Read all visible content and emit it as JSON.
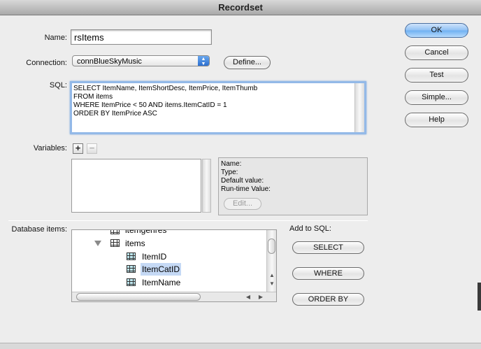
{
  "window": {
    "title": "Recordset"
  },
  "form": {
    "name_label": "Name:",
    "name_value": "rsItems",
    "connection_label": "Connection:",
    "connection_value": "connBlueSkyMusic",
    "define_button": "Define...",
    "sql_label": "SQL:",
    "sql_lines": [
      "SELECT ItemName, ItemShortDesc, ItemPrice, ItemThumb",
      "FROM items",
      "WHERE ItemPrice < 50 AND items.ItemCatID = 1",
      "ORDER BY ItemPrice ASC"
    ],
    "variables_label": "Variables:",
    "add_variable": "+",
    "remove_variable": "−",
    "variable_details": {
      "name": "Name:",
      "type": "Type:",
      "default_value": "Default value:",
      "runtime_value": "Run-time Value:",
      "edit_button": "Edit..."
    },
    "database_items_label": "Database items:",
    "add_to_sql_label": "Add to SQL:",
    "select_button": "SELECT",
    "where_button": "WHERE",
    "orderby_button": "ORDER BY"
  },
  "tree": {
    "items": [
      {
        "label": "itemgenres",
        "level": 0,
        "icon": "table-icon"
      },
      {
        "label": "items",
        "level": 0,
        "icon": "table-icon",
        "expanded": true
      },
      {
        "label": "ItemID",
        "level": 1,
        "icon": "column-icon"
      },
      {
        "label": "ItemCatID",
        "level": 1,
        "icon": "column-icon",
        "selected": true
      },
      {
        "label": "ItemName",
        "level": 1,
        "icon": "column-icon"
      }
    ]
  },
  "side_buttons": {
    "ok": "OK",
    "cancel": "Cancel",
    "test": "Test",
    "simple": "Simple...",
    "help": "Help"
  },
  "colors": {
    "accent": "#6fb0f2",
    "selection": "#c5d9f5",
    "sql_focus_ring": "#93b9e8"
  }
}
